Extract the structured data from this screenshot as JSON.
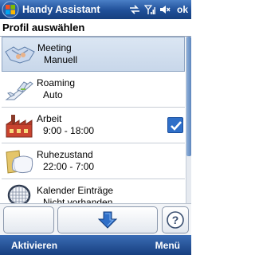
{
  "titlebar": {
    "title": "Handy Assistant",
    "ok_label": "ok",
    "icons": [
      "start-icon",
      "sync-icon",
      "signal-icon",
      "speaker-muted-icon"
    ]
  },
  "header": {
    "title": "Profil auswählen"
  },
  "profiles": [
    {
      "name": "Meeting",
      "detail": "Manuell",
      "icon": "handshake-icon",
      "selected": true,
      "checked": false
    },
    {
      "name": "Roaming",
      "detail": "Auto",
      "icon": "airplane-icon",
      "selected": false,
      "checked": false
    },
    {
      "name": "Arbeit",
      "detail": "9:00 - 18:00",
      "icon": "factory-icon",
      "selected": false,
      "checked": true
    },
    {
      "name": "Ruhezustand",
      "detail": "22:00 - 7:00",
      "icon": "pillow-icon",
      "selected": false,
      "checked": false
    },
    {
      "name": "Kalender Einträge",
      "detail": "Nicht vorhanden",
      "icon": "tennis-racket-icon",
      "selected": false,
      "checked": false
    }
  ],
  "toolbar": {
    "left_button": "",
    "down_button_icon": "arrow-down-icon",
    "help_button_icon": "help-icon"
  },
  "softkeys": {
    "left": "Aktivieren",
    "right": "Menü"
  },
  "colors": {
    "titlebar": "#1f4f98",
    "selection": "#c8d7ea",
    "accent": "#2f6fc8"
  }
}
